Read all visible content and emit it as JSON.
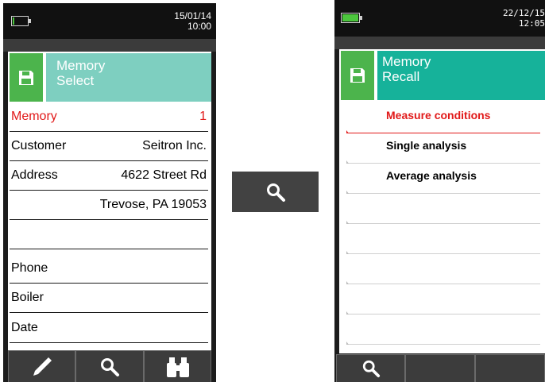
{
  "colors": {
    "accent_teal": "#7ecfc0",
    "recall_teal": "#16b29a",
    "icon_green": "#4cb44c",
    "selection_red": "#e11919",
    "battery_green": "#4cc63d"
  },
  "left_screen": {
    "status": {
      "date": "15/01/14",
      "time": "10:00",
      "battery_icon": "battery-low-icon",
      "battery_level": 0.1
    },
    "header": {
      "icon": "floppy-disk-icon",
      "title_line1": "Memory",
      "title_line2": "Select"
    },
    "rows": [
      {
        "label": "Memory",
        "value": "1"
      },
      {
        "label": "Customer",
        "value": "Seitron Inc."
      },
      {
        "label": "Address",
        "value": "4622 Street Rd"
      },
      {
        "label": "",
        "value": "Trevose, PA 19053"
      },
      {
        "label": "",
        "value": ""
      },
      {
        "label": "Phone",
        "value": ""
      },
      {
        "label": "Boiler",
        "value": ""
      },
      {
        "label": "Date",
        "value": ""
      }
    ],
    "toolbar": [
      "pencil-icon",
      "search-icon",
      "binoculars-icon"
    ]
  },
  "middle": {
    "icon": "search-icon"
  },
  "right_screen": {
    "status": {
      "date": "22/12/15",
      "time": "12:05",
      "battery_icon": "battery-full-icon",
      "battery_level": 1.0
    },
    "header": {
      "icon": "floppy-disk-icon",
      "title_line1": "Memory",
      "title_line2": "Recall"
    },
    "items": [
      {
        "label": "Measure conditions"
      },
      {
        "label": "Single analysis"
      },
      {
        "label": "Average analysis"
      },
      {
        "label": ""
      },
      {
        "label": ""
      },
      {
        "label": ""
      },
      {
        "label": ""
      },
      {
        "label": ""
      }
    ],
    "toolbar": [
      "search-icon",
      "",
      ""
    ]
  }
}
